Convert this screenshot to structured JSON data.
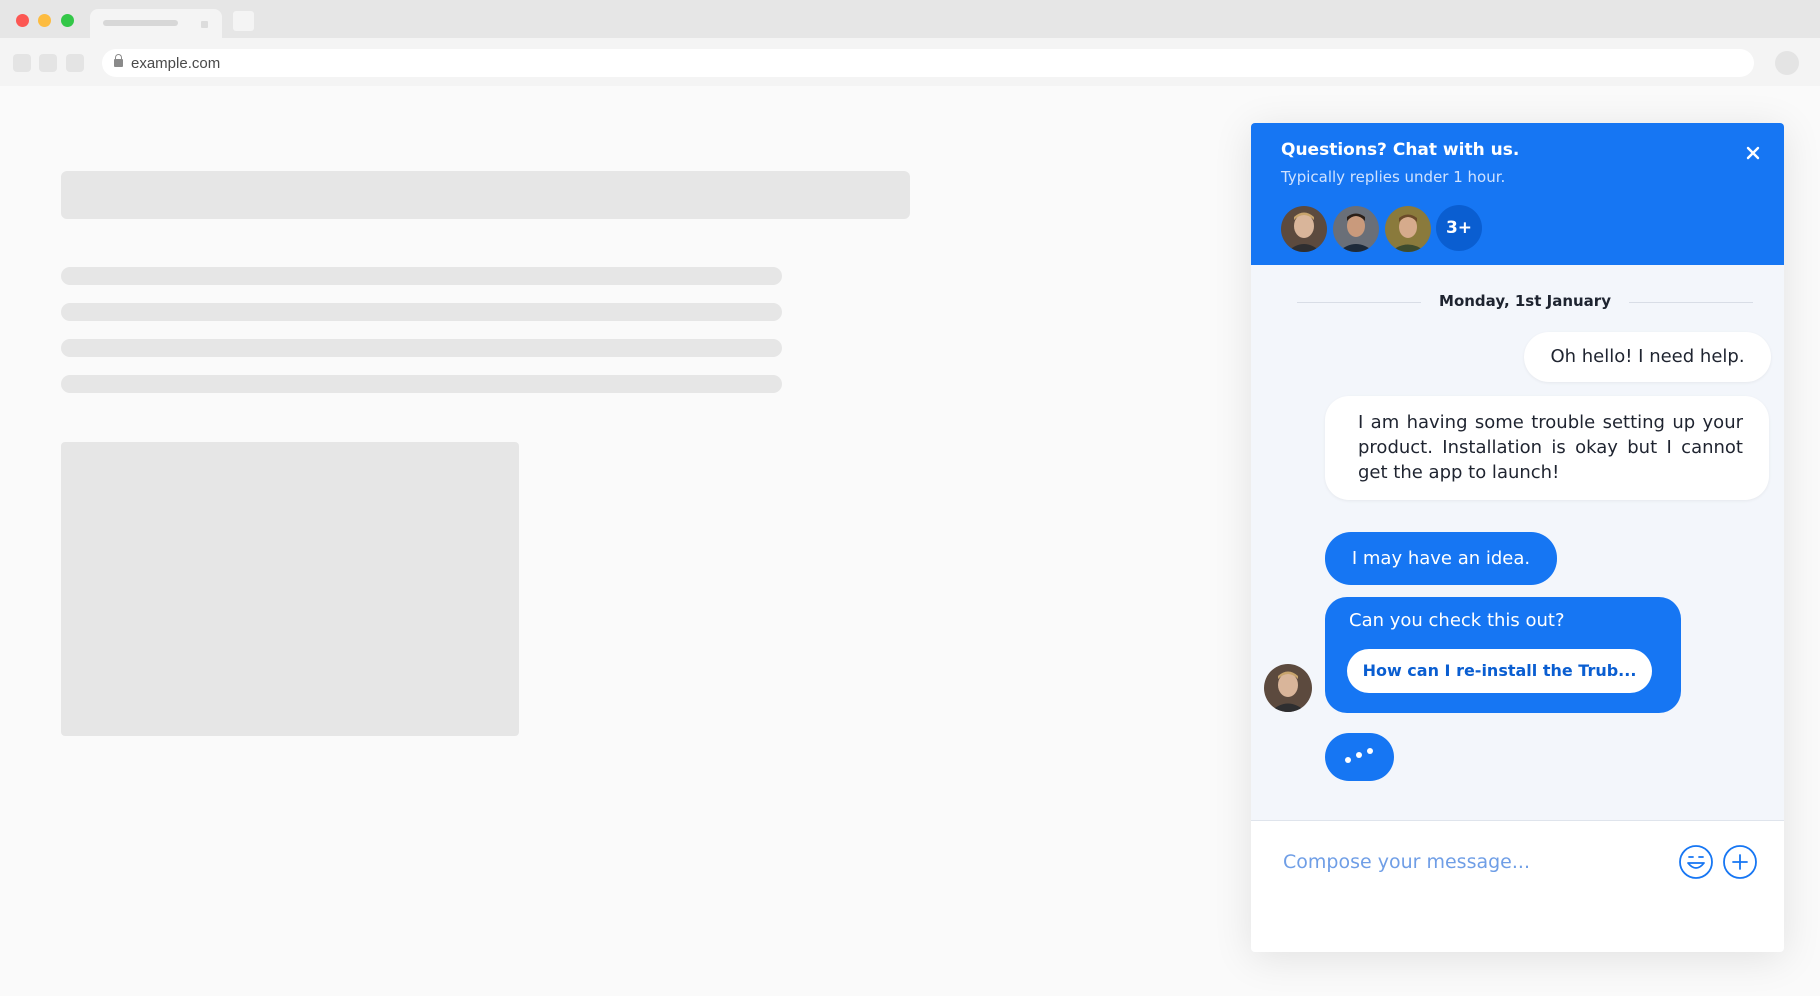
{
  "browser": {
    "url": "example.com"
  },
  "chat": {
    "header": {
      "title": "Questions? Chat with us.",
      "subtitle": "Typically replies under 1 hour.",
      "more_agents": "3+"
    },
    "date_separator": "Monday, 1st January",
    "messages": [
      {
        "side": "user",
        "text": "Oh hello! I need help."
      },
      {
        "side": "user",
        "text": "I am having some trouble setting up your product. Installation is okay but I cannot get the app to launch!"
      },
      {
        "side": "agent",
        "text": "I may have an idea."
      },
      {
        "side": "agent",
        "text": "Can you check this out?",
        "link_label": "How can I re-install the Trub..."
      }
    ],
    "composer": {
      "placeholder": "Compose your message..."
    }
  },
  "colors": {
    "accent": "#1676f3",
    "accent_dark": "#0a5ed1",
    "chat_bg": "#f3f6fb",
    "page_placeholder": "#e6e6e6"
  },
  "icons": [
    "close-icon",
    "emoji-icon",
    "plus-icon",
    "lock-icon",
    "avatar",
    "typing-indicator"
  ]
}
